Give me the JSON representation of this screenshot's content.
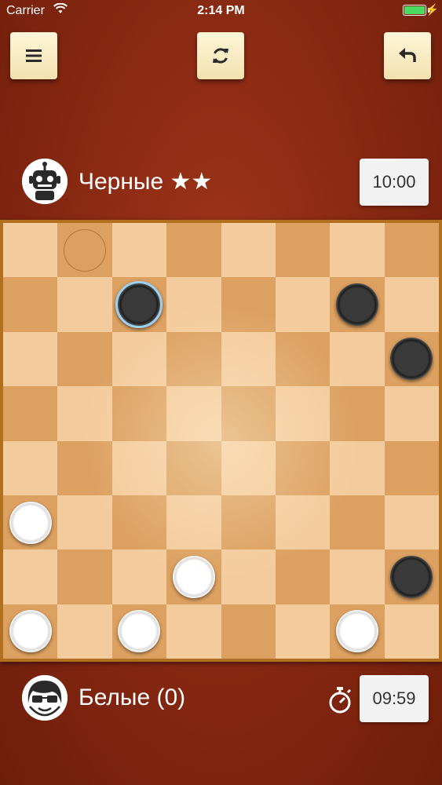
{
  "status_bar": {
    "carrier": "Carrier",
    "time": "2:14 PM"
  },
  "toolbar": {
    "menu_icon": "menu-icon",
    "restart_icon": "refresh-icon",
    "undo_icon": "undo-icon"
  },
  "top_player": {
    "name": "Черные ★★",
    "timer": "10:00",
    "avatar": "robot-avatar"
  },
  "bottom_player": {
    "name": "Белые (0)",
    "timer": "09:59",
    "avatar": "boy-glasses-avatar"
  },
  "colors": {
    "background": "#8a2a12",
    "light_square": "#f4cb9c",
    "dark_square": "#dca060",
    "button": "#f7e9bd",
    "selected_ring": "#9bd0f0"
  },
  "board": {
    "rows": 8,
    "cols": 8,
    "pieces": [
      {
        "row": 1,
        "col": 2,
        "color": "black",
        "selected": true
      },
      {
        "row": 1,
        "col": 6,
        "color": "black"
      },
      {
        "row": 2,
        "col": 7,
        "color": "black"
      },
      {
        "row": 6,
        "col": 7,
        "color": "black"
      },
      {
        "row": 5,
        "col": 0,
        "color": "white"
      },
      {
        "row": 6,
        "col": 3,
        "color": "white"
      },
      {
        "row": 7,
        "col": 0,
        "color": "white"
      },
      {
        "row": 7,
        "col": 2,
        "color": "white"
      },
      {
        "row": 7,
        "col": 6,
        "color": "white"
      }
    ],
    "move_targets": [
      {
        "row": 0,
        "col": 1
      }
    ]
  }
}
